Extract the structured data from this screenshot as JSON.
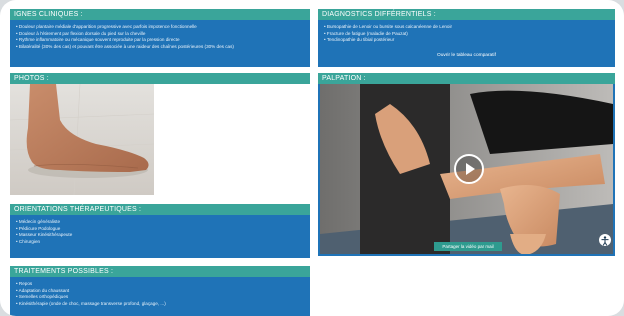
{
  "signes_cliniques": {
    "title": "IGNES CLINIQUES :",
    "items": [
      "Douleur plantaire médiale d'apparition progressive avec parfois impotence fonctionnelle",
      "Douleur à l'étirement par flexion dorsale du pied sur la cheville",
      "Rythme inflammatoire ou mécanique souvent reproduite par la pression directe",
      "Bilatéralité (30% des cas) et pouvant être associée à une raideur des chaînes postérieures (30% des cas)"
    ]
  },
  "diagnostics": {
    "title": "DIAGNOSTICS DIFFÉRENTIELS :",
    "items": [
      "Bursopathie de Lenoir ou bursite sous calcanéenne de Lenoir",
      "Fracture de fatigue (maladie de Pauzat)",
      "Tendinopathie du tibial postérieur"
    ],
    "link": "Ouvrir le tableau comparatif"
  },
  "photos": {
    "title": "PHOTOS :"
  },
  "palpation": {
    "title": "PALPATION :",
    "share": "Partager la vidéo par mail"
  },
  "orientations": {
    "title": "ORIENTATIONS THÉRAPEUTIQUES :",
    "items": [
      "Médecin généraliste",
      "Pédicure Podologue",
      "Masseur Kinésithérapeute",
      "Chirurgien"
    ]
  },
  "traitements": {
    "title": "TRAITEMENTS POSSIBLES :",
    "items": [
      "Repos",
      "Adaptation du chaussant",
      "Semelles orthopédiques",
      "Kinésithérapie (onde de choc, massage transverse profond, glaçage, ...)"
    ]
  },
  "icons": {
    "play": "play-icon",
    "accessibility": "accessibility-icon"
  },
  "colors": {
    "panel": "#1f73b7",
    "header": "#3aa59a"
  }
}
